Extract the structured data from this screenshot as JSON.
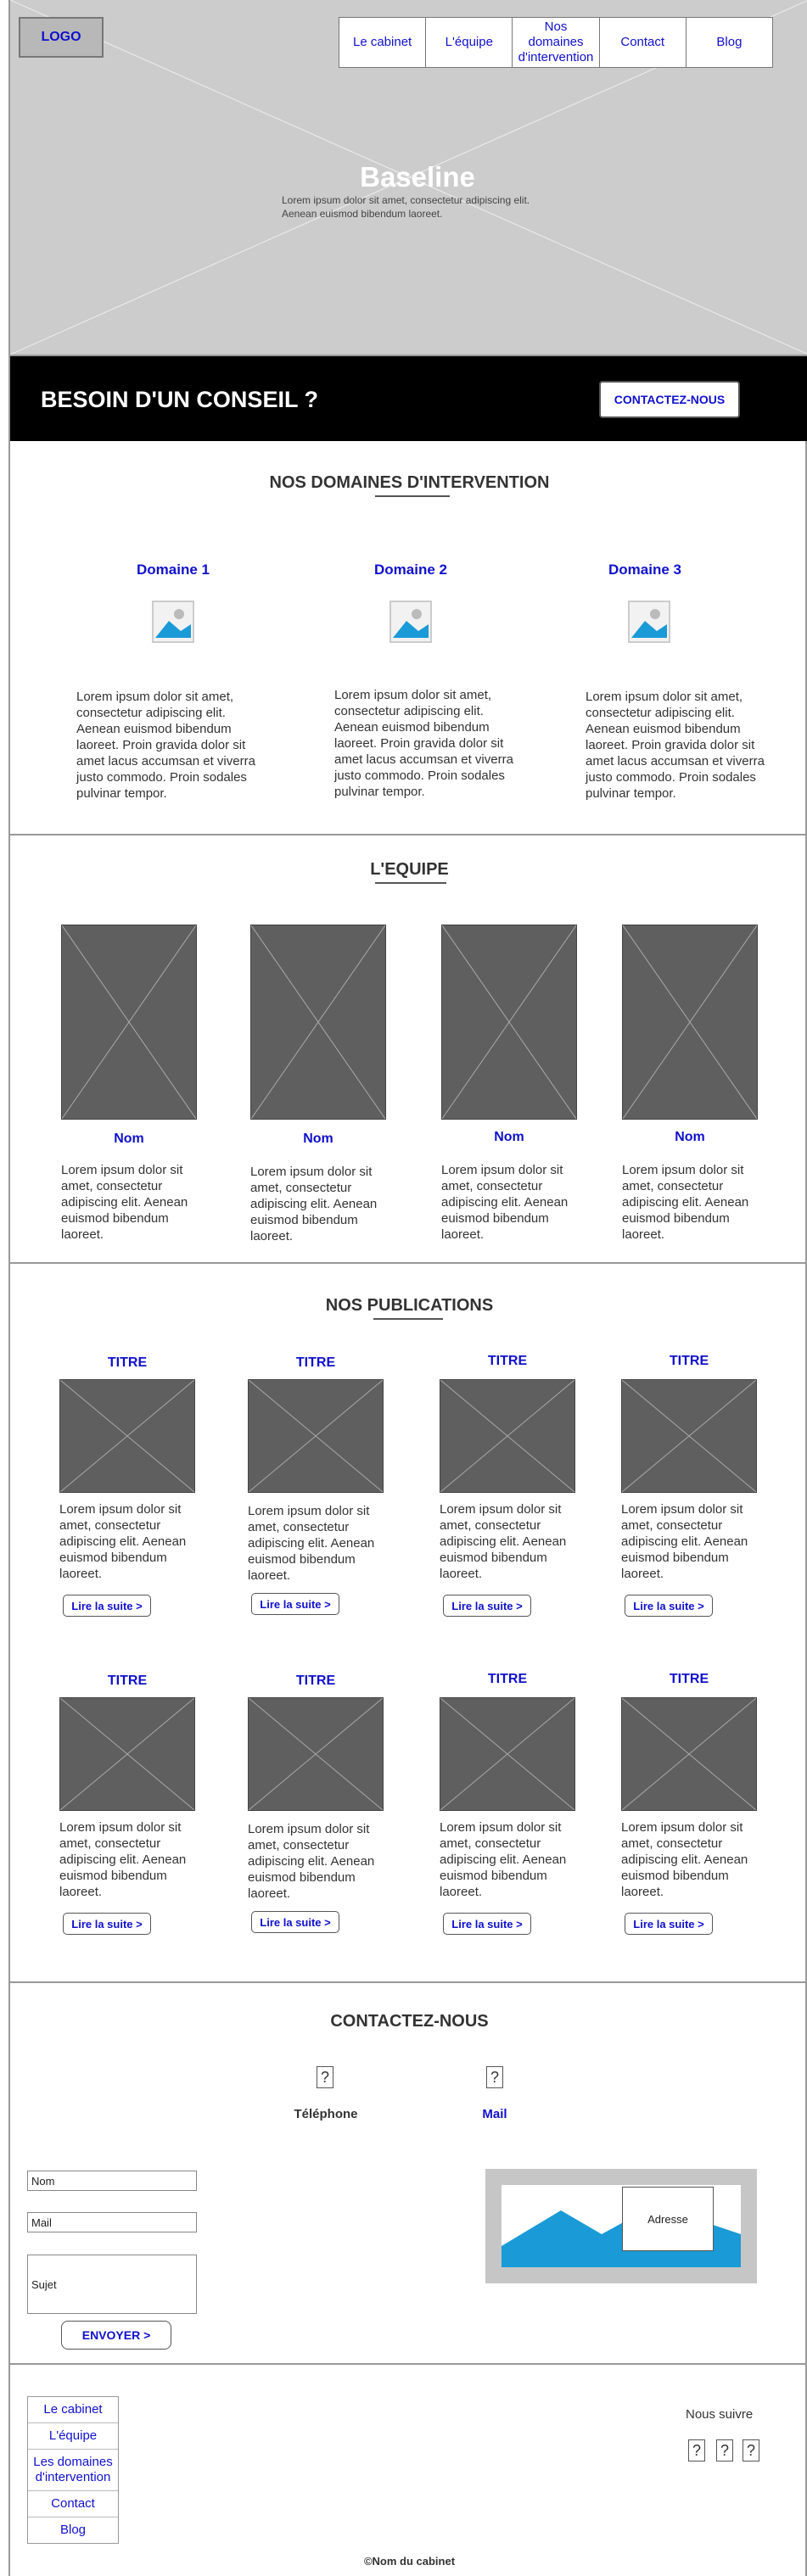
{
  "header": {
    "logo": "LOGO",
    "nav": [
      "Le cabinet",
      "L'équipe",
      "Nos domaines d'intervention",
      "Contact",
      "Blog"
    ],
    "baseline": "Baseline",
    "baseline_text": "Lorem ipsum dolor sit amet, consectetur adipiscing elit. Aenean euismod bibendum laoreet."
  },
  "cta": {
    "title": "BESOIN D'UN CONSEIL ?",
    "button": "CONTACTEZ-NOUS"
  },
  "domains": {
    "title": "NOS DOMAINES D'INTERVENTION",
    "items": [
      {
        "title": "Domaine 1",
        "text": "Lorem ipsum dolor sit amet, consectetur adipiscing elit. Aenean euismod bibendum laoreet. Proin gravida dolor sit amet lacus accumsan et viverra justo commodo. Proin sodales pulvinar tempor."
      },
      {
        "title": "Domaine 2",
        "text": "Lorem ipsum dolor sit amet, consectetur adipiscing elit. Aenean euismod bibendum laoreet. Proin gravida dolor sit amet lacus accumsan et viverra justo commodo. Proin sodales pulvinar tempor."
      },
      {
        "title": "Domaine 3",
        "text": "Lorem ipsum dolor sit amet, consectetur adipiscing elit. Aenean euismod bibendum laoreet. Proin gravida dolor sit amet lacus accumsan et viverra justo commodo. Proin sodales pulvinar tempor."
      }
    ]
  },
  "team": {
    "title": "L'EQUIPE",
    "members": [
      {
        "name": "Nom",
        "text": "Lorem ipsum dolor sit amet, consectetur adipiscing elit. Aenean euismod bibendum laoreet."
      },
      {
        "name": "Nom",
        "text": "Lorem ipsum dolor sit amet, consectetur adipiscing elit. Aenean euismod bibendum laoreet."
      },
      {
        "name": "Nom",
        "text": "Lorem ipsum dolor sit amet, consectetur adipiscing elit. Aenean euismod bibendum laoreet."
      },
      {
        "name": "Nom",
        "text": "Lorem ipsum dolor sit amet, consectetur adipiscing elit. Aenean euismod bibendum laoreet."
      }
    ]
  },
  "publications": {
    "title": "NOS PUBLICATIONS",
    "items": [
      {
        "title": "TITRE",
        "text": "Lorem ipsum dolor sit amet, consectetur adipiscing elit. Aenean euismod bibendum laoreet.",
        "button": "Lire la suite >"
      },
      {
        "title": "TITRE",
        "text": "Lorem ipsum dolor sit amet, consectetur adipiscing elit. Aenean euismod bibendum laoreet.",
        "button": "Lire la suite >"
      },
      {
        "title": "TITRE",
        "text": "Lorem ipsum dolor sit amet, consectetur adipiscing elit. Aenean euismod bibendum laoreet.",
        "button": "Lire la suite >"
      },
      {
        "title": "TITRE",
        "text": "Lorem ipsum dolor sit amet, consectetur adipiscing elit. Aenean euismod bibendum laoreet.",
        "button": "Lire la suite >"
      },
      {
        "title": "TITRE",
        "text": "Lorem ipsum dolor sit amet, consectetur adipiscing elit. Aenean euismod bibendum laoreet.",
        "button": "Lire la suite >"
      },
      {
        "title": "TITRE",
        "text": "Lorem ipsum dolor sit amet, consectetur adipiscing elit. Aenean euismod bibendum laoreet.",
        "button": "Lire la suite >"
      },
      {
        "title": "TITRE",
        "text": "Lorem ipsum dolor sit amet, consectetur adipiscing elit. Aenean euismod bibendum laoreet.",
        "button": "Lire la suite >"
      },
      {
        "title": "TITRE",
        "text": "Lorem ipsum dolor sit amet, consectetur adipiscing elit. Aenean euismod bibendum laoreet.",
        "button": "Lire la suite >"
      }
    ]
  },
  "contact": {
    "title": "CONTACTEZ-NOUS",
    "icon_glyph": "?",
    "phone_label": "Téléphone",
    "mail_label": "Mail",
    "fields": {
      "name": "Nom",
      "mail": "Mail",
      "subject": "Sujet"
    },
    "send": "ENVOYER >",
    "address": "Adresse"
  },
  "footer": {
    "nav": [
      "Le cabinet",
      "L'équipe",
      "Les domaines d'intervention",
      "Contact",
      "Blog"
    ],
    "follow": "Nous suivre",
    "social_glyph": "?",
    "copyright": "©Nom du cabinet"
  },
  "colors": {
    "link": "#1010cc",
    "cta_bg": "#000000",
    "placeholder": "#5f5f5f",
    "map_blue": "#1a9ad6"
  }
}
